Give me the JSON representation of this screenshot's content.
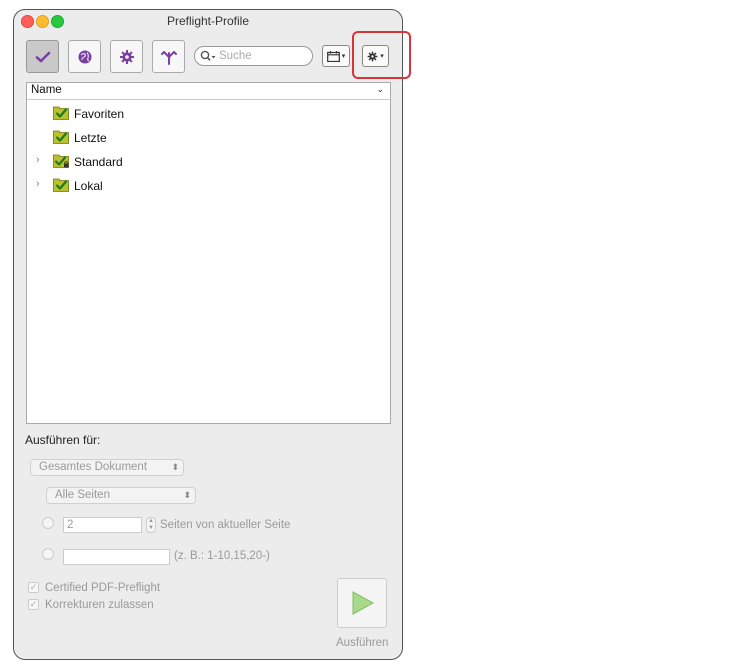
{
  "window": {
    "title": "Preflight-Profile"
  },
  "toolbar": {
    "search_placeholder": "Suche",
    "buttons": [
      {
        "icon": "checkmark-icon",
        "active": true
      },
      {
        "icon": "globe-icon",
        "active": false
      },
      {
        "icon": "gear-icon",
        "active": false
      },
      {
        "icon": "branch-icon",
        "active": false
      }
    ],
    "view_menu_icon": "calendar-icon",
    "options_menu_icon": "gear-icon"
  },
  "tree": {
    "header": "Name",
    "items": [
      {
        "label": "Favoriten",
        "expandable": false
      },
      {
        "label": "Letzte",
        "expandable": false
      },
      {
        "label": "Standard",
        "expandable": true,
        "locked": true
      },
      {
        "label": "Lokal",
        "expandable": true,
        "locked": false
      }
    ]
  },
  "run_for": {
    "label": "Ausführen für:",
    "scope_select": "Gesamtes Dokument",
    "pages_select": "Alle Seiten",
    "pages_count_value": "2",
    "pages_count_suffix": "Seiten von aktueller Seite",
    "range_value": "",
    "range_hint": "(z. B.: 1-10,15,20-)"
  },
  "options": {
    "certified": "Certified PDF-Preflight",
    "corrections": "Korrekturen zulassen"
  },
  "run_button": {
    "label": "Ausführen"
  },
  "colors": {
    "accent_purple": "#7b3fa0",
    "check_green": "#39a935",
    "highlight_red": "#d9343a"
  }
}
